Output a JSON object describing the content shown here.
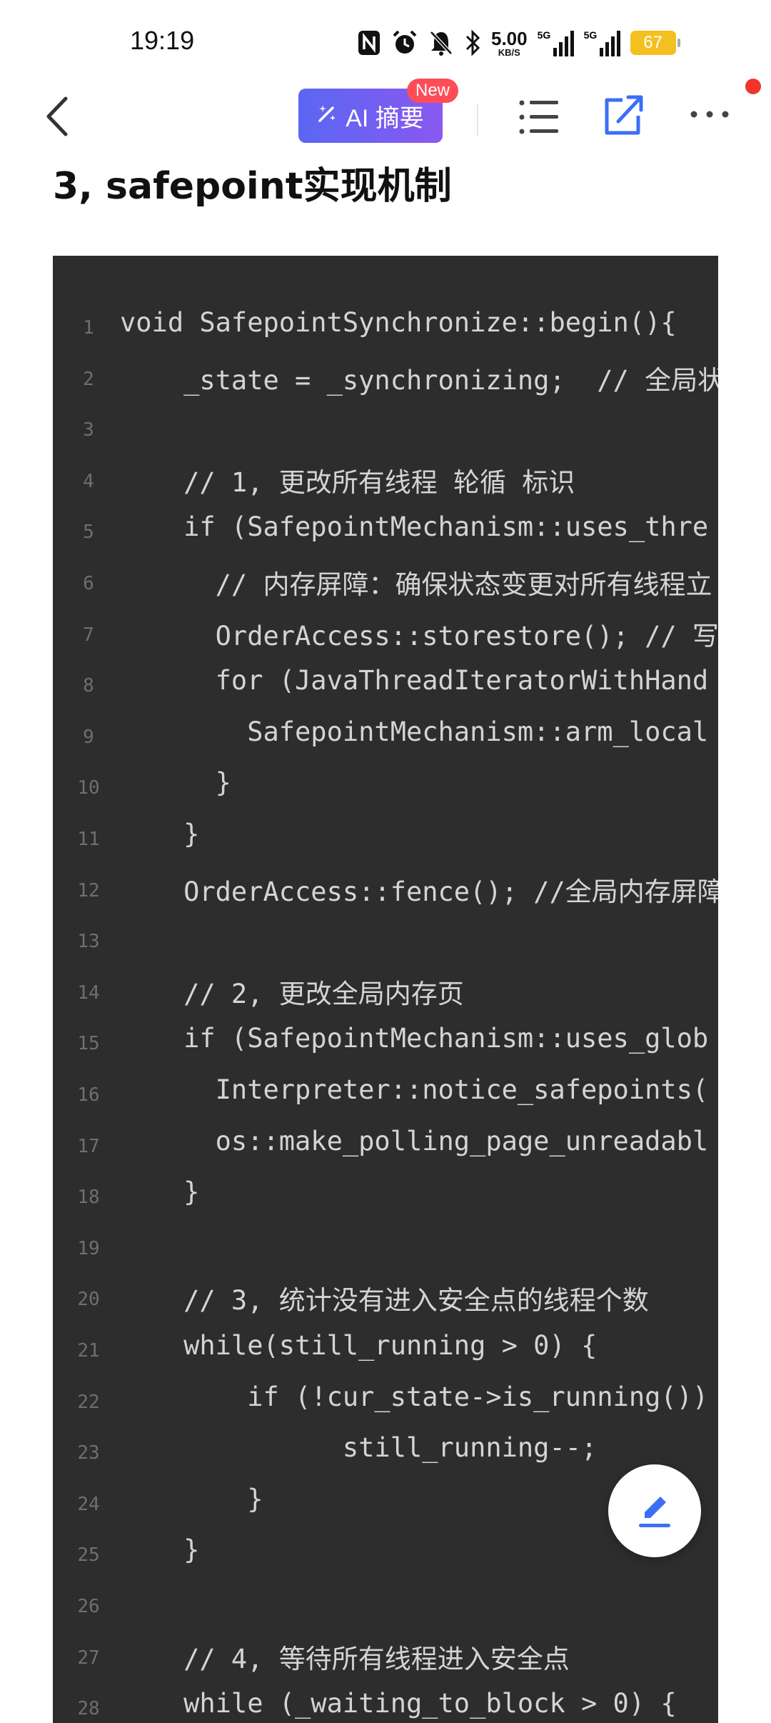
{
  "status_bar": {
    "time": "19:19",
    "speed_value": "5.00",
    "speed_unit": "KB/S",
    "signal_tag_1": "5G",
    "signal_tag_2": "5G",
    "battery": "67"
  },
  "nav": {
    "ai_summary_label": "AI 摘要",
    "new_badge": "New",
    "icons": [
      "back-icon",
      "spark-icon",
      "table-of-contents-icon",
      "share-icon",
      "more-icon"
    ]
  },
  "article": {
    "heading": "3, safepoint实现机制"
  },
  "code": {
    "lines": [
      {
        "n": "1",
        "text": "void SafepointSynchronize::begin(){"
      },
      {
        "n": "2",
        "text": "    _state = _synchronizing;  // 全局状"
      },
      {
        "n": "3",
        "text": ""
      },
      {
        "n": "4",
        "text": "    // 1, 更改所有线程 轮循 标识"
      },
      {
        "n": "5",
        "text": "    if (SafepointMechanism::uses_thre"
      },
      {
        "n": "6",
        "text": "      // 内存屏障：确保状态变更对所有线程立"
      },
      {
        "n": "7",
        "text": "      OrderAccess::storestore(); // 写"
      },
      {
        "n": "8",
        "text": "      for (JavaThreadIteratorWithHand"
      },
      {
        "n": "9",
        "text": "        SafepointMechanism::arm_local"
      },
      {
        "n": "10",
        "text": "      }"
      },
      {
        "n": "11",
        "text": "    }"
      },
      {
        "n": "12",
        "text": "    OrderAccess::fence(); //全局内存屏障"
      },
      {
        "n": "13",
        "text": ""
      },
      {
        "n": "14",
        "text": "    // 2, 更改全局内存页"
      },
      {
        "n": "15",
        "text": "    if (SafepointMechanism::uses_glob"
      },
      {
        "n": "16",
        "text": "      Interpreter::notice_safepoints("
      },
      {
        "n": "17",
        "text": "      os::make_polling_page_unreadabl"
      },
      {
        "n": "18",
        "text": "    }"
      },
      {
        "n": "19",
        "text": ""
      },
      {
        "n": "20",
        "text": "    // 3, 统计没有进入安全点的线程个数"
      },
      {
        "n": "21",
        "text": "    while(still_running > 0) {"
      },
      {
        "n": "22",
        "text": "        if (!cur_state->is_running())"
      },
      {
        "n": "23",
        "text": "              still_running--;"
      },
      {
        "n": "24",
        "text": "        }"
      },
      {
        "n": "25",
        "text": "    }"
      },
      {
        "n": "26",
        "text": ""
      },
      {
        "n": "27",
        "text": "    // 4, 等待所有线程进入安全点"
      },
      {
        "n": "28",
        "text": "    while (_waiting_to_block > 0) {"
      }
    ]
  },
  "fab": {
    "icon": "edit-icon"
  },
  "colors": {
    "code_bg": "#2d2d2e",
    "code_text": "#d4d4d4",
    "line_number": "#6f6f73",
    "accent": "#3d6ef5",
    "ai_gradient_start": "#5a67f2",
    "ai_gradient_end": "#8a58f0",
    "badge": "#ff4d57",
    "battery": "#f4c020"
  }
}
